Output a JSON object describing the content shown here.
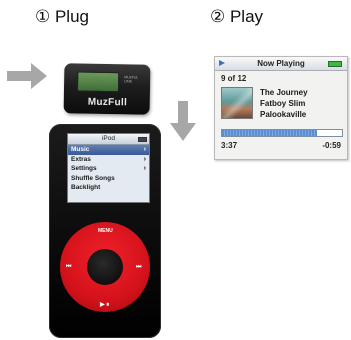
{
  "steps": {
    "step1": "① Plug",
    "step2": "② Play"
  },
  "adapter": {
    "brand": "MuzFull",
    "mini_label": "MUZFUL\nLINE",
    "lcd_color": "#5a8a4a"
  },
  "ipod": {
    "screen_title": "iPod",
    "menu": [
      {
        "label": "Music",
        "arrow": "›",
        "selected": true
      },
      {
        "label": "Extras",
        "arrow": "›",
        "selected": false
      },
      {
        "label": "Settings",
        "arrow": "›",
        "selected": false
      },
      {
        "label": "Shuffle Songs",
        "arrow": "",
        "selected": false
      },
      {
        "label": "Backlight",
        "arrow": "",
        "selected": false
      }
    ],
    "wheel": {
      "menu_label": "MENU",
      "prev_glyph": "⏮",
      "next_glyph": "⏭",
      "playpause_glyph": "▶ ⏸"
    },
    "wheel_color": "#d4121b"
  },
  "now_playing": {
    "title": "Now Playing",
    "track_count": "9 of 12",
    "song": "The Journey",
    "artist": "Fatboy Slim",
    "album": "Palookaville",
    "elapsed": "3:37",
    "remaining": "-0:59",
    "progress": 0.79,
    "accent": "#5c8ed1"
  },
  "arrows": {
    "color": "#a7a7a7",
    "right_arrow": "arrow-right-icon",
    "down_arrow": "arrow-down-icon"
  }
}
